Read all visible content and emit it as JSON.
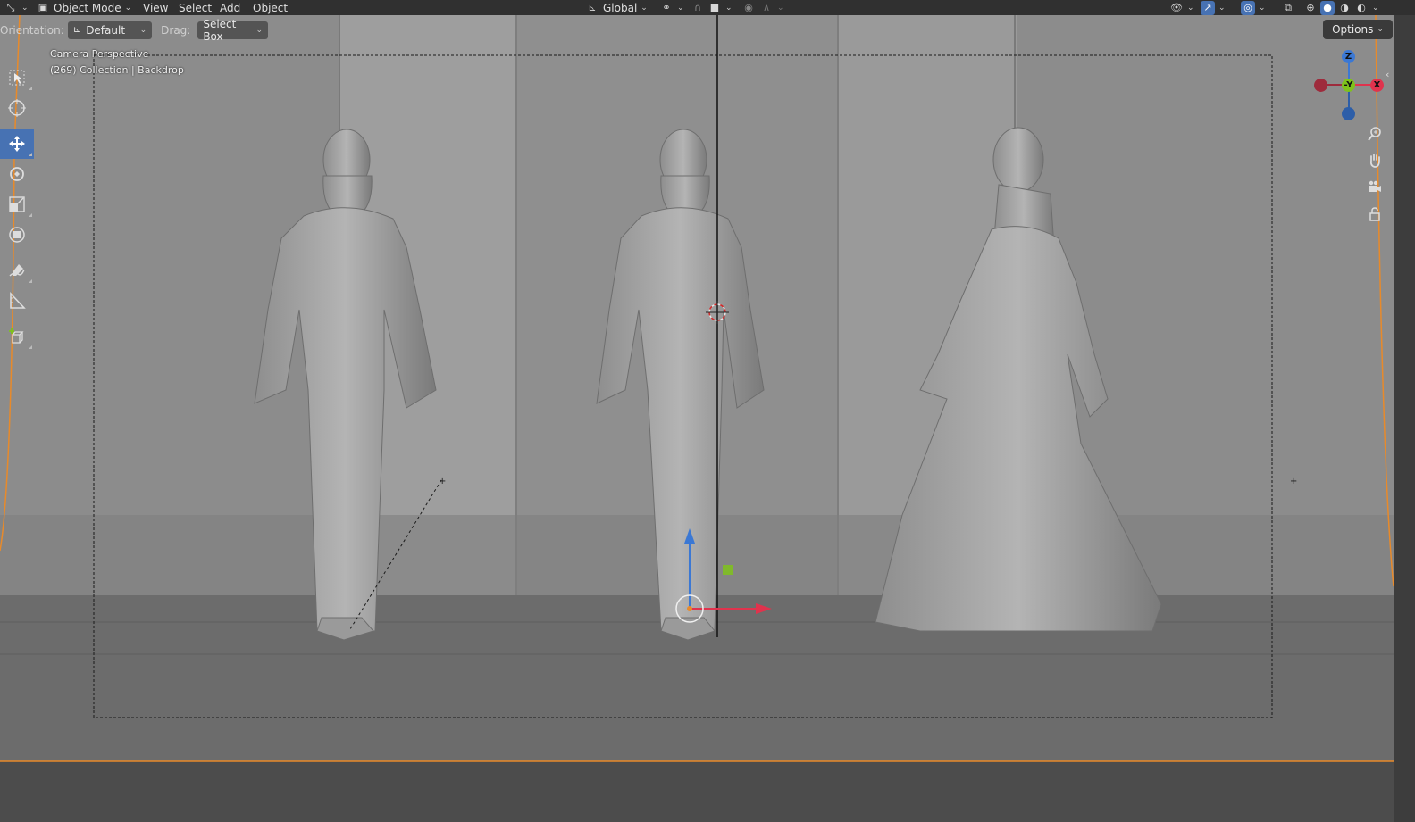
{
  "header": {
    "editor_type_icon": "orientation-axes-icon",
    "mode": "Object Mode",
    "menus": [
      "View",
      "Select",
      "Add",
      "Object"
    ],
    "transform_orientation": "Global"
  },
  "tool_settings": {
    "orientation_label": "Orientation:",
    "orientation_value": "Default",
    "drag_label": "Drag:",
    "drag_value": "Select Box",
    "options_label": "Options"
  },
  "viewport": {
    "view_name": "Camera Perspective",
    "collection_info": "(269) Collection | Backdrop"
  },
  "gizmo": {
    "z": "Z",
    "y": "-Y",
    "x": "X"
  },
  "toolbar": {
    "tools": [
      "select-box",
      "cursor",
      "move",
      "rotate",
      "scale",
      "transform",
      "annotate",
      "measure",
      "add-cube"
    ],
    "active_tool": "move"
  },
  "colors": {
    "accent": "#4772b3",
    "header_bg": "#303030",
    "viewport_bg": "#6a6a6a",
    "selection_orange": "#e88a2a",
    "axis_x": "#e0334d",
    "axis_y": "#7fc21c",
    "axis_z": "#3b78d4"
  }
}
